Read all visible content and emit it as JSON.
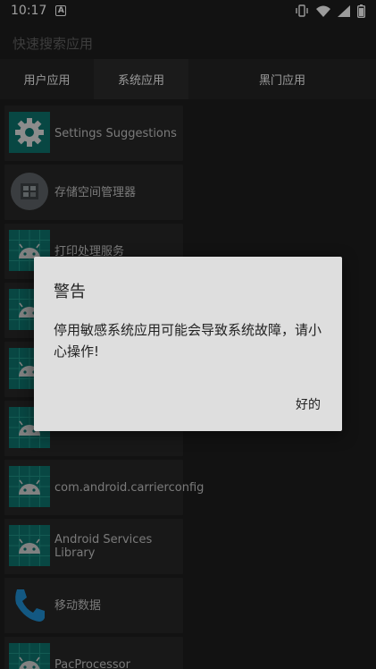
{
  "status": {
    "time": "10:17",
    "notification_letter": "A"
  },
  "search": {
    "placeholder": "快速搜索应用"
  },
  "tabs": [
    {
      "label": "用户应用"
    },
    {
      "label": "系统应用"
    },
    {
      "label": "黑门应用"
    }
  ],
  "apps": [
    {
      "label": "Settings Suggestions",
      "icon": "gear-icon"
    },
    {
      "label": "存储空间管理器",
      "icon": "storage-manager-icon"
    },
    {
      "label": "打印处理服务",
      "icon": "android-icon"
    },
    {
      "label": "",
      "icon": "android-icon"
    },
    {
      "label": "",
      "icon": "android-icon"
    },
    {
      "label": "",
      "icon": "android-icon"
    },
    {
      "label": "com.android.carrierconfig",
      "icon": "android-icon"
    },
    {
      "label": "Android Services Library",
      "icon": "android-icon"
    },
    {
      "label": "移动数据",
      "icon": "phone-icon"
    },
    {
      "label": "PacProcessor",
      "icon": "android-icon"
    }
  ],
  "dialog": {
    "title": "警告",
    "message": "停用敏感系统应用可能会导致系统故障，请小心操作!",
    "ok_label": "好的"
  },
  "colors": {
    "android_tile": "#0d6e68",
    "grid_line": "#1f8c80",
    "android_gray": "#c7c7c7",
    "phone_blue": "#1e88c8"
  }
}
